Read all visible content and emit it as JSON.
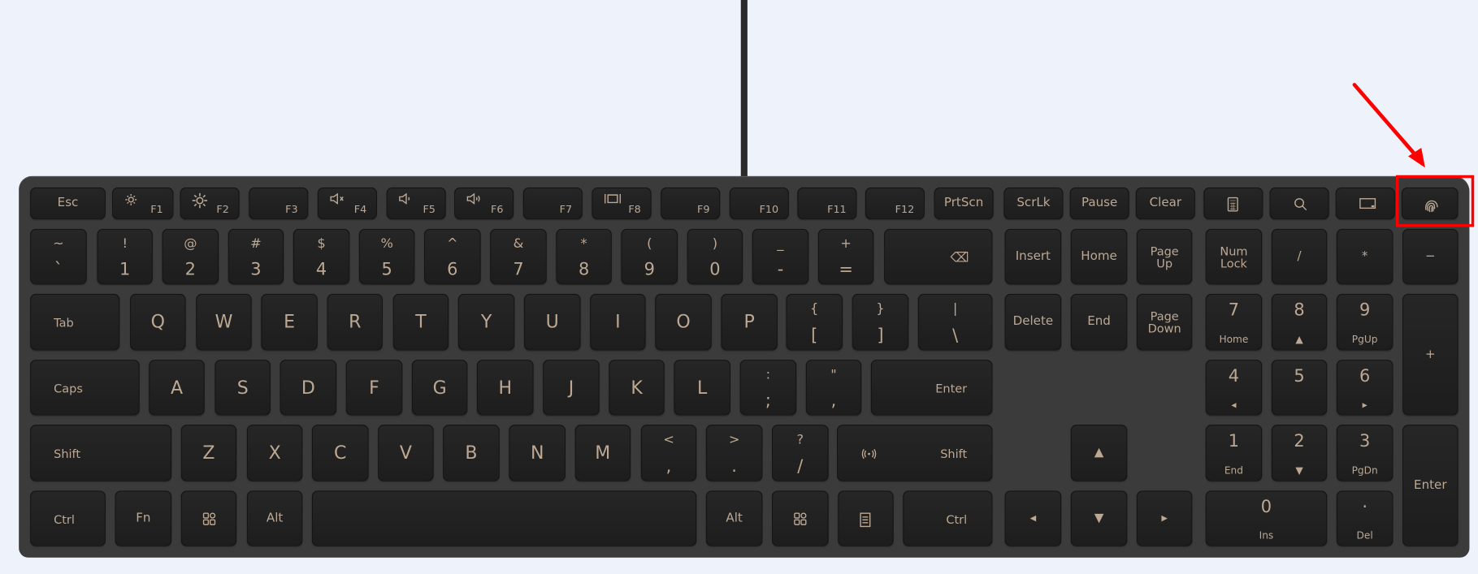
{
  "colors": {
    "background": "#eef3fb",
    "keyboard": "#3b3b3c",
    "key": "#1f1f1f",
    "legend": "#bca893",
    "highlight": "#ff0000"
  },
  "highlight": {
    "target_key": "fingerprint",
    "style": "red box with red arrow"
  },
  "rows": [
    [
      {
        "main": "Esc"
      },
      {
        "icon": "brightness-down-icon",
        "fn": "F1"
      },
      {
        "icon": "brightness-up-icon",
        "fn": "F2"
      },
      {
        "fn": "F3"
      },
      {
        "icon": "mute-icon",
        "fn": "F4"
      },
      {
        "icon": "volume-down-icon",
        "fn": "F5"
      },
      {
        "icon": "volume-up-icon",
        "fn": "F6"
      },
      {
        "fn": "F7"
      },
      {
        "icon": "projection-icon",
        "fn": "F8"
      },
      {
        "fn": "F9"
      },
      {
        "fn": "F10"
      },
      {
        "fn": "F11"
      },
      {
        "fn": "F12"
      },
      {
        "main": "PrtScn"
      },
      {
        "main": "ScrLk"
      },
      {
        "main": "Pause"
      },
      {
        "main": "Clear"
      },
      {
        "icon": "calculator-icon"
      },
      {
        "icon": "search-icon"
      },
      {
        "icon": "window-icon"
      },
      {
        "icon": "fingerprint-icon"
      }
    ],
    [
      {
        "top": "~",
        "bottom": "`"
      },
      {
        "top": "!",
        "bottom": "1"
      },
      {
        "top": "@",
        "bottom": "2"
      },
      {
        "top": "#",
        "bottom": "3"
      },
      {
        "top": "$",
        "bottom": "4"
      },
      {
        "top": "%",
        "bottom": "5"
      },
      {
        "top": "^",
        "bottom": "6"
      },
      {
        "top": "&",
        "bottom": "7"
      },
      {
        "top": "*",
        "bottom": "8"
      },
      {
        "top": "(",
        "bottom": "9"
      },
      {
        "top": ")",
        "bottom": "0"
      },
      {
        "top": "_",
        "bottom": "-"
      },
      {
        "top": "+",
        "bottom": "="
      },
      {
        "right": "⌫"
      },
      {
        "main": "Insert"
      },
      {
        "main": "Home"
      },
      {
        "main": "Page\nUp"
      },
      {
        "main": "Num\nLock"
      },
      {
        "main": "/"
      },
      {
        "main": "*"
      },
      {
        "main": "−"
      }
    ],
    [
      {
        "left": "Tab"
      },
      {
        "big": "Q"
      },
      {
        "big": "W"
      },
      {
        "big": "E"
      },
      {
        "big": "R"
      },
      {
        "big": "T"
      },
      {
        "big": "Y"
      },
      {
        "big": "U"
      },
      {
        "big": "I"
      },
      {
        "big": "O"
      },
      {
        "big": "P"
      },
      {
        "top": "{",
        "bottom": "["
      },
      {
        "top": "}",
        "bottom": "]"
      },
      {
        "top": "|",
        "bottom": "\\"
      },
      {
        "main": "Delete"
      },
      {
        "main": "End"
      },
      {
        "main": "Page\nDown"
      },
      {
        "top": "7",
        "sub": "Home"
      },
      {
        "top": "8",
        "sub": "▲"
      },
      {
        "top": "9",
        "sub": "PgUp"
      },
      {
        "main": "+"
      }
    ],
    [
      {
        "left": "Caps"
      },
      {
        "big": "A"
      },
      {
        "big": "S"
      },
      {
        "big": "D"
      },
      {
        "big": "F"
      },
      {
        "big": "G"
      },
      {
        "big": "H"
      },
      {
        "big": "J"
      },
      {
        "big": "K"
      },
      {
        "big": "L"
      },
      {
        "top": ":",
        "bottom": ";"
      },
      {
        "top": "\"",
        "bottom": ","
      },
      {
        "right": "Enter"
      },
      {
        "top": "4",
        "sub": "◂"
      },
      {
        "top": "5",
        "sub": ""
      },
      {
        "top": "6",
        "sub": "▸"
      }
    ],
    [
      {
        "left": "Shift"
      },
      {
        "big": "Z"
      },
      {
        "big": "X"
      },
      {
        "big": "C"
      },
      {
        "big": "V"
      },
      {
        "big": "B"
      },
      {
        "big": "N"
      },
      {
        "big": "M"
      },
      {
        "top": "<",
        "bottom": ","
      },
      {
        "top": ">",
        "bottom": "."
      },
      {
        "top": "?",
        "bottom": "/"
      },
      {
        "right": "Shift",
        "icon": "wireless-icon"
      },
      {
        "main": "▲"
      },
      {
        "top": "1",
        "sub": "End"
      },
      {
        "top": "2",
        "sub": "▼"
      },
      {
        "top": "3",
        "sub": "PgDn"
      },
      {
        "main": "Enter"
      }
    ],
    [
      {
        "left": "Ctrl"
      },
      {
        "main": "Fn"
      },
      {
        "icon": "windows-icon"
      },
      {
        "main": "Alt"
      },
      {
        "main": ""
      },
      {
        "main": "Alt"
      },
      {
        "icon": "windows-icon"
      },
      {
        "icon": "menu-icon"
      },
      {
        "right": "Ctrl"
      },
      {
        "main": "◂"
      },
      {
        "main": "▼"
      },
      {
        "main": "▸"
      },
      {
        "top": "0",
        "sub": "Ins"
      },
      {
        "top": "·",
        "sub": "Del"
      }
    ]
  ]
}
